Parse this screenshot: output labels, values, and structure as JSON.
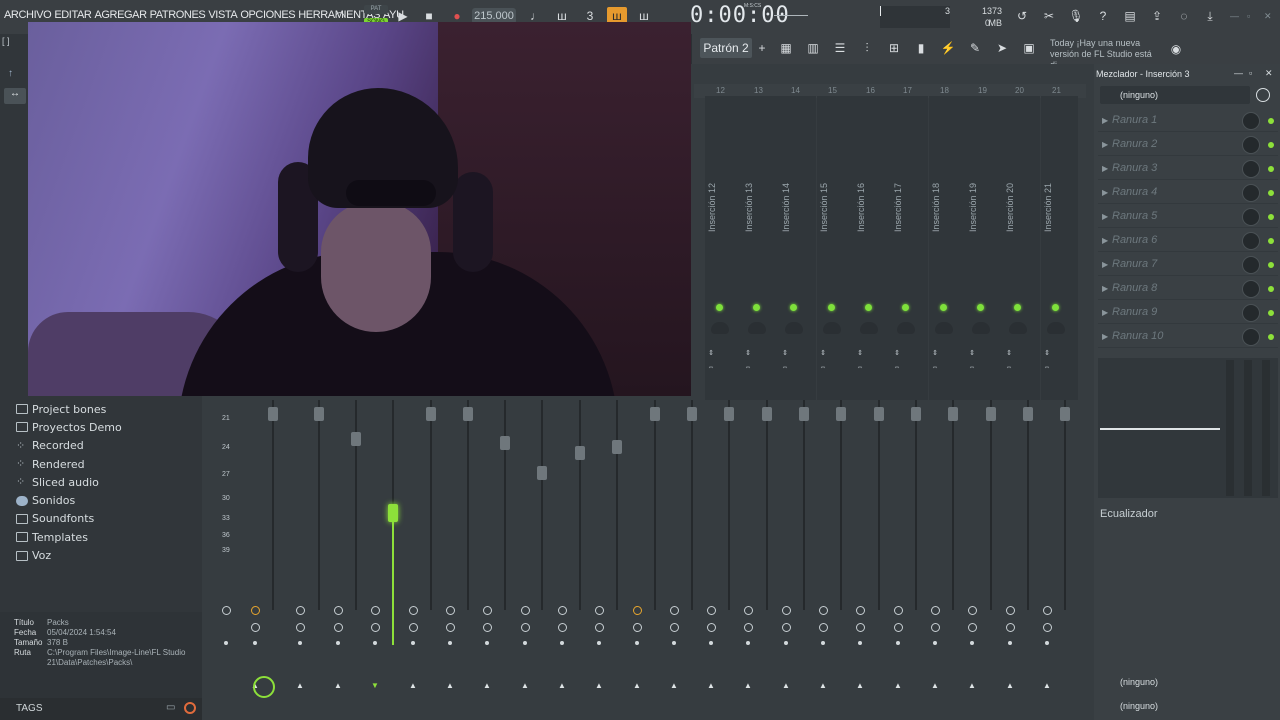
{
  "menu": [
    "ARCHIVO",
    "EDITAR",
    "AGREGAR",
    "PATRONES",
    "VISTA",
    "OPCIONES",
    "HERRAMIENTAS",
    "AYU"
  ],
  "transport": {
    "tempo": "215.000",
    "time": "0:00:00",
    "time_unit": "M:S:CS",
    "song_badge": "SONG",
    "pat_badge": "PAT"
  },
  "status": {
    "mem": "1373 MB",
    "poly": "3",
    "cpu": "0"
  },
  "pattern": {
    "label": "Patrón 2"
  },
  "news": {
    "today": "Today",
    "text": "¡Hay una nueva versión de FL Studio está di..."
  },
  "browser": {
    "folders": [
      "Project bones",
      "Proyectos Demo",
      "Recorded",
      "Rendered",
      "Sliced audio",
      "Sonidos",
      "Soundfonts",
      "Templates",
      "Voz"
    ],
    "info": {
      "title_label": "Título",
      "title_value": "Packs",
      "date_label": "Fecha",
      "date_value": "05/04/2024 1:54:54",
      "size_label": "Tamaño",
      "size_value": "378 B",
      "path_label": "Ruta",
      "path_value": "C:\\Program Files\\Image-Line\\FL Studio 21\\Data\\Patches\\Packs\\"
    },
    "tags_label": "TAGS"
  },
  "mixer": {
    "ruler": [
      "12",
      "13",
      "14",
      "15",
      "16",
      "17",
      "18",
      "19",
      "20",
      "21"
    ],
    "inserts": [
      "Inserción 12",
      "Inserción 13",
      "Inserción 14",
      "Inserción 15",
      "Inserción 16",
      "Inserción 17",
      "Inserción 18",
      "Inserción 19",
      "Inserción 20",
      "Inserción 21"
    ],
    "scale": [
      "21",
      "24",
      "27",
      "30",
      "33",
      "36",
      "39"
    ]
  },
  "mixer_panel": {
    "title": "Mezclador - Inserción 3",
    "input": "(ninguno)",
    "slots": [
      "Ranura 1",
      "Ranura 2",
      "Ranura 3",
      "Ranura 4",
      "Ranura 5",
      "Ranura 6",
      "Ranura 7",
      "Ranura 8",
      "Ranura 9",
      "Ranura 10"
    ],
    "eq_label": "Ecualizador",
    "output_top": "(ninguno)",
    "output_bottom": "(ninguno)"
  },
  "colors": {
    "accent_green": "#8de03a",
    "record_red": "#e05050",
    "panel": "#3a4044"
  }
}
